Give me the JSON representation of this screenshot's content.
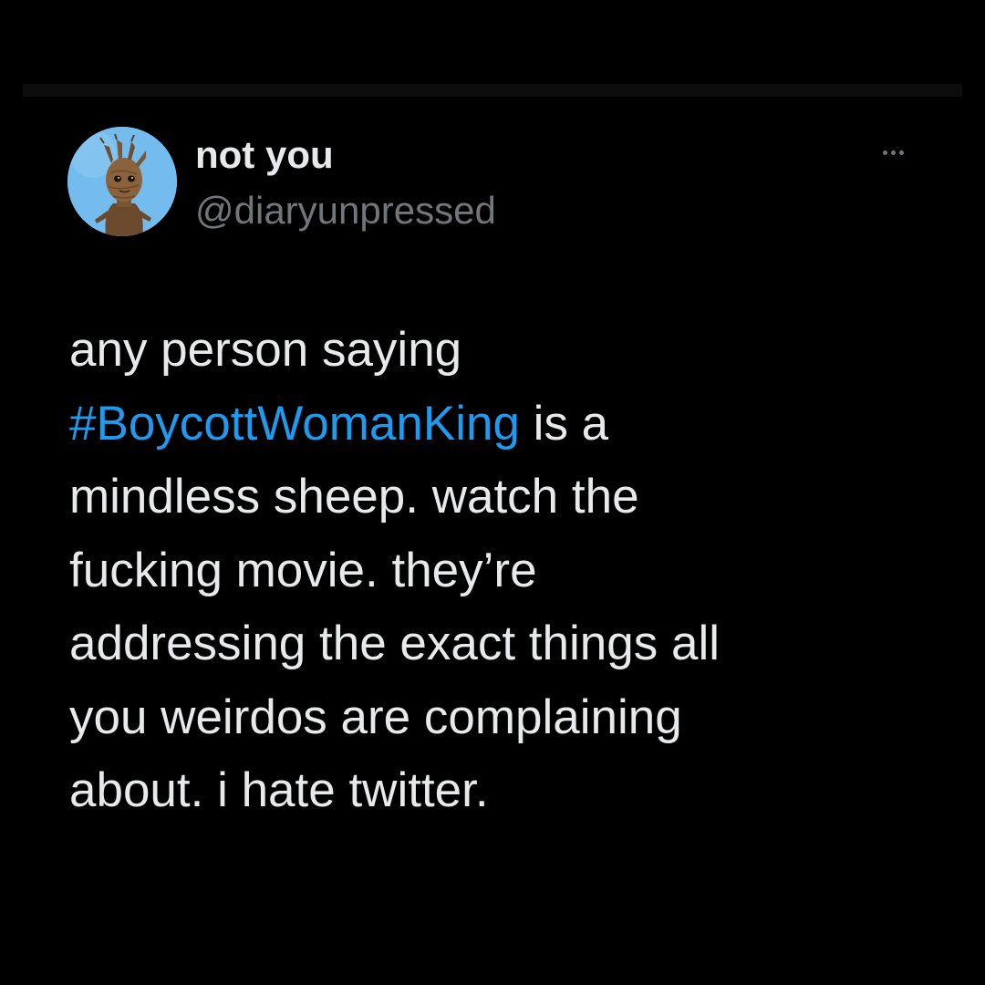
{
  "tweet": {
    "author": {
      "display_name": "not you",
      "handle": "@diaryunpressed",
      "avatar_icon": "groot-avatar"
    },
    "more_icon": "more-horizontal-icon",
    "text": {
      "line1": "any person saying",
      "hashtag": "#BoycottWomanKing",
      "line2_rest": " is a",
      "line3": "mindless sheep. watch the",
      "line4": "fucking movie. they’re",
      "line5": "addressing the exact things all",
      "line6": "you weirdos are complaining",
      "line7": "about. i hate twitter."
    }
  },
  "colors": {
    "background": "#000000",
    "text_primary": "#e7e9ea",
    "text_secondary": "#71767b",
    "link": "#1d9bf0",
    "avatar_bg": "#6fb8ec"
  }
}
